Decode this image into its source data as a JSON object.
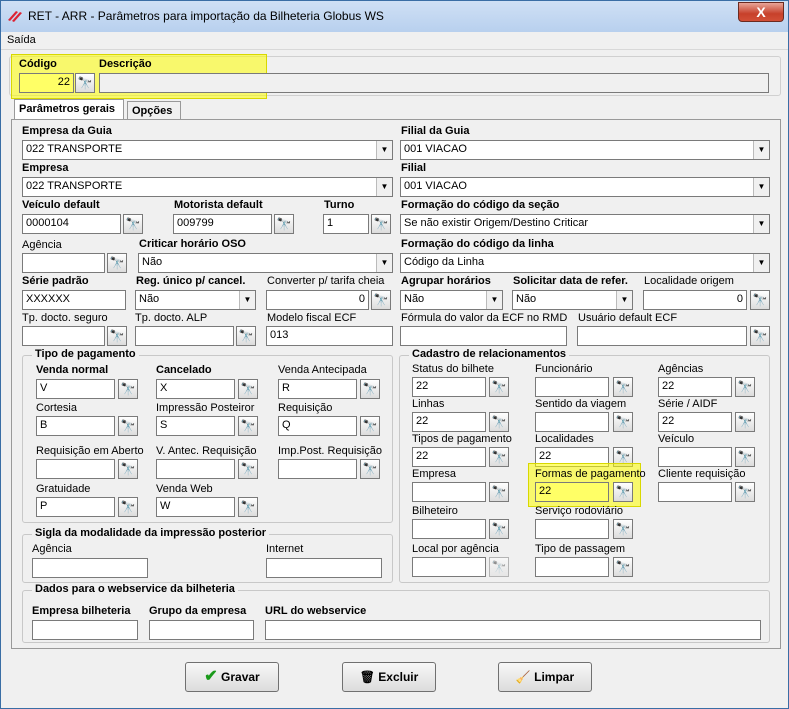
{
  "window": {
    "title": "RET - ARR - Parâmetros para importação da Bilheteria Globus WS",
    "close": "X"
  },
  "menu": {
    "items": [
      {
        "label": "Saída"
      }
    ]
  },
  "header": {
    "codigo_label": "Código",
    "codigo_value": "22",
    "descricao_label": "Descrição"
  },
  "tabs": [
    {
      "label": "Parâmetros gerais"
    },
    {
      "label": "Opções"
    }
  ],
  "empresa_guia": {
    "label": "Empresa da Guia",
    "value": "022 TRANSPORTE"
  },
  "filial_guia": {
    "label": "Filial da Guia",
    "value": "001 VIACAO"
  },
  "empresa": {
    "label": "Empresa",
    "value": "022 TRANSPORTE"
  },
  "filial": {
    "label": "Filial",
    "value": "001 VIACAO"
  },
  "veiculo_default": {
    "label": "Veículo default",
    "value": "0000104"
  },
  "motorista_default": {
    "label": "Motorista default",
    "value": "009799"
  },
  "turno": {
    "label": "Turno",
    "value": "1"
  },
  "formacao_secao": {
    "label": "Formação do código da seção",
    "value": "Se não existir Origem/Destino Criticar"
  },
  "agencia": {
    "label": "Agência",
    "value": ""
  },
  "criticar_oso": {
    "label": "Criticar horário OSO",
    "value": "Não"
  },
  "formacao_linha": {
    "label": "Formação do código da linha",
    "value": "Código da Linha"
  },
  "serie_padrao": {
    "label": "Série  padrão",
    "value": "XXXXXX"
  },
  "reg_unico": {
    "label": "Reg. único p/ cancel.",
    "value": "Não"
  },
  "converter_tarifa": {
    "label": "Converter p/ tarifa cheia",
    "value": "0"
  },
  "agrupar_horarios": {
    "label": "Agrupar horários",
    "value": "Não"
  },
  "solicitar_data": {
    "label": "Solicitar data de refer.",
    "value": "Não"
  },
  "localidade_origem": {
    "label": "Localidade origem",
    "value": "0"
  },
  "tp_docto_seguro": {
    "label": "Tp. docto. seguro",
    "value": ""
  },
  "tp_docto_alp": {
    "label": "Tp. docto. ALP",
    "value": ""
  },
  "modelo_fiscal": {
    "label": "Modelo fiscal ECF",
    "value": "013"
  },
  "formula_ecf": {
    "label": "Fórmula do valor da ECF no RMD",
    "value": ""
  },
  "usuario_ecf": {
    "label": "Usuário default ECF",
    "value": ""
  },
  "tipo_pagamento": {
    "title": "Tipo de pagamento",
    "venda_normal": {
      "label": "Venda normal",
      "value": "V"
    },
    "cancelado": {
      "label": "Cancelado",
      "value": "X"
    },
    "venda_antecipada": {
      "label": "Venda Antecipada",
      "value": "R"
    },
    "cortesia": {
      "label": "Cortesia",
      "value": "B"
    },
    "impressao_posterior": {
      "label": "Impressão Posteiror",
      "value": "S"
    },
    "requisicao": {
      "label": "Requisição",
      "value": "Q"
    },
    "requisicao_aberto": {
      "label": "Requisição em Aberto",
      "value": ""
    },
    "v_antec_requisicao": {
      "label": "V. Antec. Requisição",
      "value": ""
    },
    "imp_post_requisicao": {
      "label": "Imp.Post. Requisição",
      "value": ""
    },
    "gratuidade": {
      "label": "Gratuidade",
      "value": "P"
    },
    "venda_web": {
      "label": "Venda Web",
      "value": "W"
    }
  },
  "cadastro": {
    "title": "Cadastro de relacionamentos",
    "status_bilhete": {
      "label": "Status do bilhete",
      "value": "22"
    },
    "funcionario": {
      "label": "Funcionário",
      "value": ""
    },
    "agencias": {
      "label": "Agências",
      "value": "22"
    },
    "linhas": {
      "label": "Linhas",
      "value": "22"
    },
    "sentido_viagem": {
      "label": "Sentido da viagem",
      "value": ""
    },
    "serie_aidf": {
      "label": "Série / AIDF",
      "value": "22"
    },
    "tipos_pagamento": {
      "label": "Tipos de pagamento",
      "value": "22"
    },
    "localidades": {
      "label": "Localidades",
      "value": "22"
    },
    "veiculo": {
      "label": "Veículo",
      "value": ""
    },
    "empresa": {
      "label": "Empresa",
      "value": ""
    },
    "formas_pagamento": {
      "label": "Formas de pagamento",
      "value": "22"
    },
    "cliente_requisicao": {
      "label": "Cliente requisição",
      "value": ""
    },
    "bilheteiro": {
      "label": "Bilheteiro",
      "value": ""
    },
    "servico_rodoviario": {
      "label": "Serviço rodoviário",
      "value": ""
    },
    "local_agencia": {
      "label": "Local por agência",
      "value": ""
    },
    "tipo_passagem": {
      "label": "Tipo de passagem",
      "value": ""
    }
  },
  "sigla": {
    "title": "Sigla da modalidade da impressão posterior",
    "agencia": "Agência",
    "internet": "Internet"
  },
  "webservice": {
    "title": "Dados para o webservice da bilheteria",
    "empresa_bilheteria": "Empresa bilheteria",
    "grupo_empresa": "Grupo da empresa",
    "url": "URL do webservice"
  },
  "actions": {
    "gravar": "Gravar",
    "excluir": "Excluir",
    "limpar": "Limpar"
  },
  "colors": {
    "highlight": "#ffff00",
    "green_check": "#1a9a1a"
  }
}
